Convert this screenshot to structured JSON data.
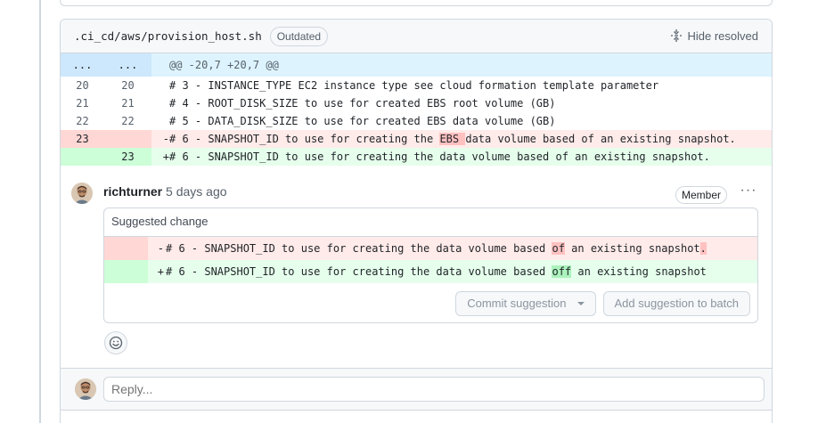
{
  "file": {
    "path": ".ci_cd/aws/provision_host.sh",
    "badge": "Outdated",
    "hide_resolved": "Hide resolved"
  },
  "diff": {
    "hunk_left": "...",
    "hunk_right": "...",
    "hunk_header": "@@ -20,7 +20,7 @@",
    "lines": [
      {
        "old": "20",
        "new": "20",
        "sign": "",
        "text": "# 3 - INSTANCE_TYPE EC2 instance type see cloud formation template parameter"
      },
      {
        "old": "21",
        "new": "21",
        "sign": "",
        "text": "# 4 - ROOT_DISK_SIZE to use for created EBS root volume (GB)"
      },
      {
        "old": "22",
        "new": "22",
        "sign": "",
        "text": "# 5 - DATA_DISK_SIZE to use for created EBS data volume (GB)"
      }
    ],
    "del_line": {
      "old": "23",
      "sign": "-",
      "pre": "# 6 - SNAPSHOT_ID to use for creating the ",
      "hl": "EBS ",
      "post": "data volume based of an existing snapshot."
    },
    "add_line": {
      "new": "23",
      "sign": "+",
      "text": "# 6 - SNAPSHOT_ID to use for creating the data volume based of an existing snapshot."
    }
  },
  "comment": {
    "author": "richturner",
    "time": "5 days ago",
    "role": "Member",
    "more": "···",
    "suggestion_title": "Suggested change",
    "sugg_del": {
      "sign": "-",
      "pre": "# 6 - SNAPSHOT_ID to use for creating the data volume based ",
      "hl": "of",
      "mid": " an existing snapshot",
      "hl2": ".",
      "post": ""
    },
    "sugg_add": {
      "sign": "+",
      "pre": "# 6 - SNAPSHOT_ID to use for creating the data volume based ",
      "hl": "off",
      "post": " an existing snapshot"
    },
    "commit_button": "Commit suggestion",
    "batch_button": "Add suggestion to batch"
  },
  "reply": {
    "placeholder": "Reply..."
  },
  "icons": {
    "hide_resolved": "fold-icon",
    "emoji": "smiley-icon",
    "more": "kebab-horizontal-icon"
  }
}
